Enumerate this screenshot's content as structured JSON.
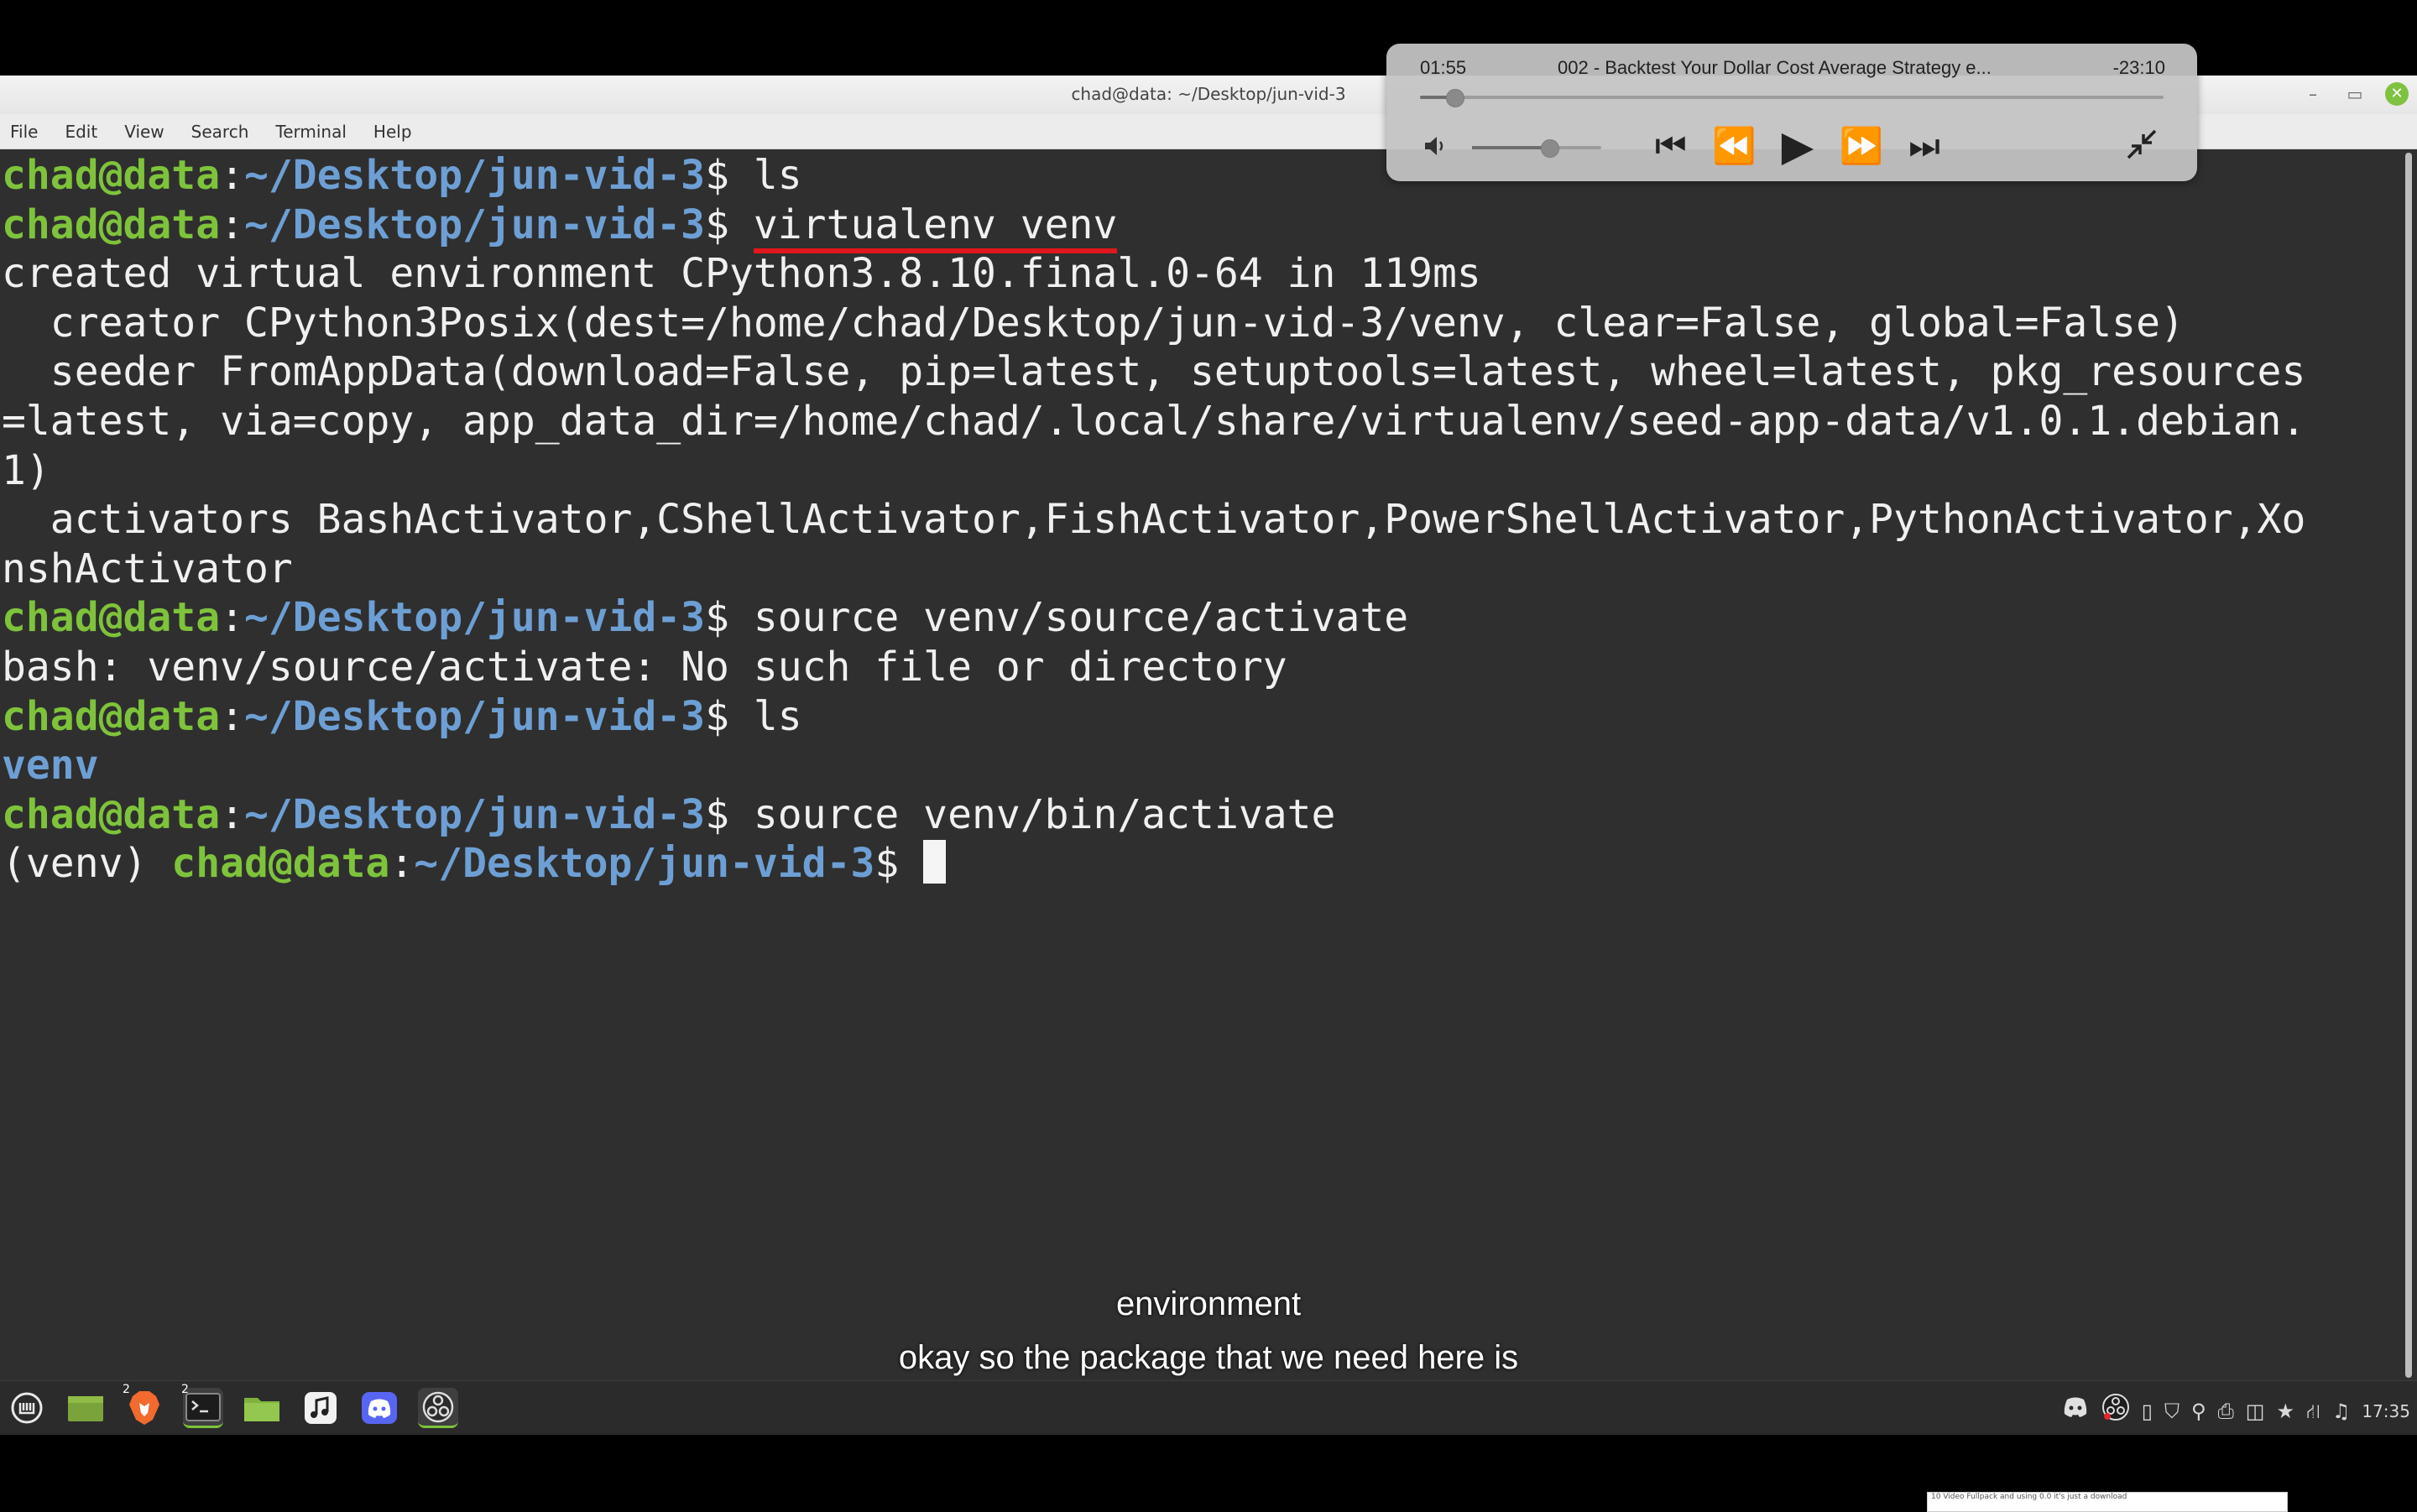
{
  "window": {
    "title": "chad@data: ~/Desktop/jun-vid-3",
    "controls": {
      "minimize": "–",
      "maximize": "▭",
      "close": "✕"
    }
  },
  "menu": [
    "File",
    "Edit",
    "View",
    "Search",
    "Terminal",
    "Help"
  ],
  "terminal": {
    "prompt_user": "chad@data",
    "prompt_path": "~/Desktop/jun-vid-3",
    "prompt_sym": "$ ",
    "lines": {
      "cmd1": "ls",
      "cmd2": "virtualenv venv",
      "out1": "created virtual environment CPython3.8.10.final.0-64 in 119ms",
      "out2": "  creator CPython3Posix(dest=/home/chad/Desktop/jun-vid-3/venv, clear=False, global=False)",
      "out3": "  seeder FromAppData(download=False, pip=latest, setuptools=latest, wheel=latest, pkg_resources",
      "out4": "=latest, via=copy, app_data_dir=/home/chad/.local/share/virtualenv/seed-app-data/v1.0.1.debian.",
      "out5": "1)",
      "out6": "  activators BashActivator,CShellActivator,FishActivator,PowerShellActivator,PythonActivator,Xo",
      "out7": "nshActivator",
      "cmd3": "source venv/source/activate",
      "out8": "bash: venv/source/activate: No such file or directory",
      "cmd4": "ls",
      "out9": "venv",
      "cmd5": "source venv/bin/activate",
      "venv_prefix": "(venv) "
    }
  },
  "subtitles": {
    "line1": "environment",
    "line2": "okay so the package that we need here is"
  },
  "player": {
    "elapsed": "01:55",
    "title": "002 - Backtest Your Dollar Cost Average Strategy e...",
    "remaining": "-23:10",
    "progress_fraction": 0.046,
    "volume_fraction": 0.6,
    "icons": {
      "volume": "volume-icon",
      "skip_back": "skip-back-icon",
      "rewind": "rewind-icon",
      "play": "play-icon",
      "fast_forward": "fast-forward-icon",
      "skip_forward": "skip-forward-icon",
      "minimize": "minimize-player-icon"
    }
  },
  "taskbar": {
    "brave_badge": "2",
    "terminal_badge": "2",
    "clock": "17:35"
  },
  "mini_preview": "10 Video Fullpack and using 0.0 it's just a  download"
}
